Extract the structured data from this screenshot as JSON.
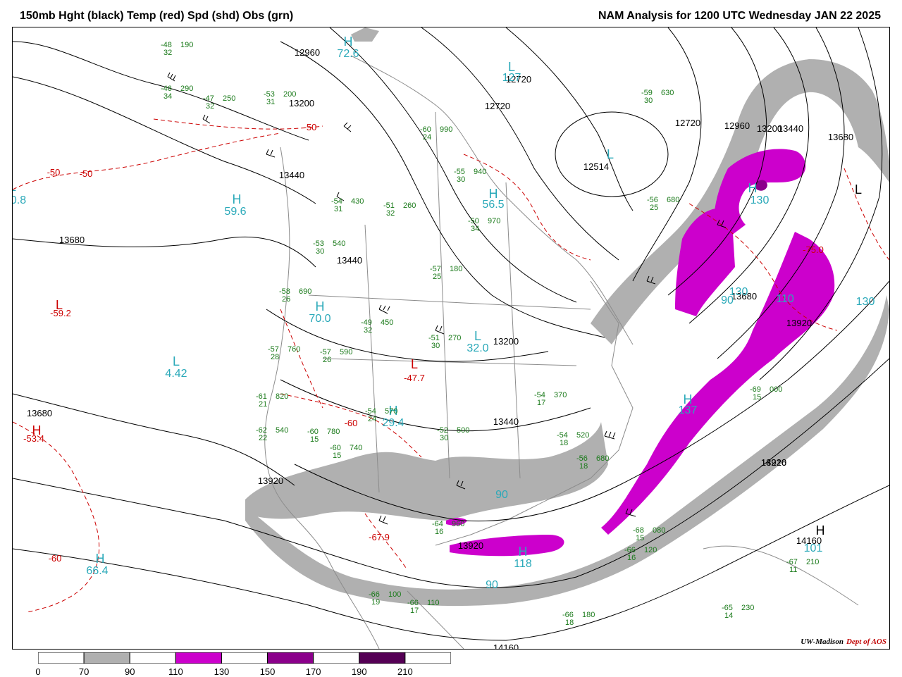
{
  "header": {
    "left_title": "150mb Hght (black) Temp (red) Spd (shd) Obs (grn)",
    "right_title": "NAM Analysis for 1200 UTC Wednesday  JAN 22 2025"
  },
  "credit": {
    "org": "UW-Madison",
    "dept": "Dept of AOS"
  },
  "colors": {
    "height_contour": "#000000",
    "temp_contour": "#cc0000",
    "obs": "#1a7a1a",
    "speed_label": "#2aa9b9",
    "geography": "#8c8c8c"
  },
  "colorbar": {
    "ticks": [
      "0",
      "70",
      "90",
      "110",
      "130",
      "150",
      "170",
      "190",
      "210"
    ],
    "bins": [
      {
        "from": 0,
        "to": 70,
        "color": "#ffffff"
      },
      {
        "from": 70,
        "to": 90,
        "color": "#b0b0b0"
      },
      {
        "from": 90,
        "to": 110,
        "color": "#ffffff"
      },
      {
        "from": 110,
        "to": 130,
        "color": "#cc00cc"
      },
      {
        "from": 130,
        "to": 150,
        "color": "#ffffff"
      },
      {
        "from": 150,
        "to": 170,
        "color": "#8b008b"
      },
      {
        "from": 170,
        "to": 190,
        "color": "#ffffff"
      },
      {
        "from": 190,
        "to": 210,
        "color": "#550055"
      },
      {
        "from": 210,
        "to": 230,
        "color": "#ffffff"
      }
    ]
  },
  "height_labels": [
    "12960",
    "13200",
    "13440",
    "13680",
    "12720",
    "12720",
    "12514",
    "12720",
    "12960",
    "13200",
    "13440",
    "13680",
    "13680",
    "13440",
    "13680",
    "13920",
    "13200",
    "13440",
    "13920",
    "13920",
    "13920",
    "14160",
    "14216",
    "14160"
  ],
  "temp_labels": [
    "-50",
    "-50",
    "-50",
    "-59.2",
    "-53.4",
    "-60",
    "-60",
    "-47.7",
    "-67.9",
    "-75.0"
  ],
  "speed_labels": [
    "72.6",
    "127",
    "0.8",
    "59.6",
    "56.5",
    "70.0",
    "4.42",
    "32.0",
    "29.4",
    "90",
    "110",
    "66.4",
    "90",
    "118",
    "137",
    "130",
    "130",
    "90",
    "101",
    "130"
  ],
  "hl_markers": [
    "H",
    "L",
    "L",
    "L",
    "H",
    "H",
    "H",
    "L",
    "L",
    "L",
    "H",
    "L",
    "H",
    "H",
    "H",
    "H",
    "L",
    "H",
    "H"
  ],
  "obs_sample": [
    {
      "t": "-48",
      "d": "32",
      "h": "190"
    },
    {
      "t": "-46",
      "d": "34",
      "h": "290"
    },
    {
      "t": "-47",
      "d": "32",
      "h": "250"
    },
    {
      "t": "-53",
      "d": "31",
      "h": "200"
    },
    {
      "t": "-60",
      "d": "24",
      "h": "990"
    },
    {
      "t": "-55",
      "d": "30",
      "h": "940"
    },
    {
      "t": "-59",
      "d": "30",
      "h": "630"
    },
    {
      "t": "-56",
      "d": "25",
      "h": "680"
    },
    {
      "t": "-54",
      "d": "31",
      "h": "430"
    },
    {
      "t": "-51",
      "d": "32",
      "h": "260"
    },
    {
      "t": "-50",
      "d": "34",
      "h": "970"
    },
    {
      "t": "-53",
      "d": "30",
      "h": "540"
    },
    {
      "t": "-57",
      "d": "25",
      "h": "180"
    },
    {
      "t": "-58",
      "d": "26",
      "h": "690"
    },
    {
      "t": "-49",
      "d": "32",
      "h": "450"
    },
    {
      "t": "-51",
      "d": "30",
      "h": "270"
    },
    {
      "t": "-57",
      "d": "26",
      "h": "590"
    },
    {
      "t": "-57",
      "d": "28",
      "h": "760"
    },
    {
      "t": "-61",
      "d": "21",
      "h": "820"
    },
    {
      "t": "-62",
      "d": "22",
      "h": "540"
    },
    {
      "t": "-60",
      "d": "15",
      "h": "780"
    },
    {
      "t": "-60",
      "d": "15",
      "h": "740"
    },
    {
      "t": "-54",
      "d": "24",
      "h": "570"
    },
    {
      "t": "-52",
      "d": "30",
      "h": "500"
    },
    {
      "t": "-54",
      "d": "17",
      "h": "370"
    },
    {
      "t": "-54",
      "d": "18",
      "h": "520"
    },
    {
      "t": "-56",
      "d": "18",
      "h": "680"
    },
    {
      "t": "-64",
      "d": "16",
      "h": "960"
    },
    {
      "t": "-66",
      "d": "16",
      "h": "120"
    },
    {
      "t": "-66",
      "d": "18",
      "h": "180"
    },
    {
      "t": "-65",
      "d": "14",
      "h": "230"
    },
    {
      "t": "-67",
      "d": "11",
      "h": "210"
    },
    {
      "t": "-68",
      "d": "15",
      "h": "080"
    },
    {
      "t": "-69",
      "d": "15",
      "h": "000"
    },
    {
      "t": "-66",
      "d": "19",
      "h": "100"
    },
    {
      "t": "-66",
      "d": "17",
      "h": "110"
    }
  ]
}
